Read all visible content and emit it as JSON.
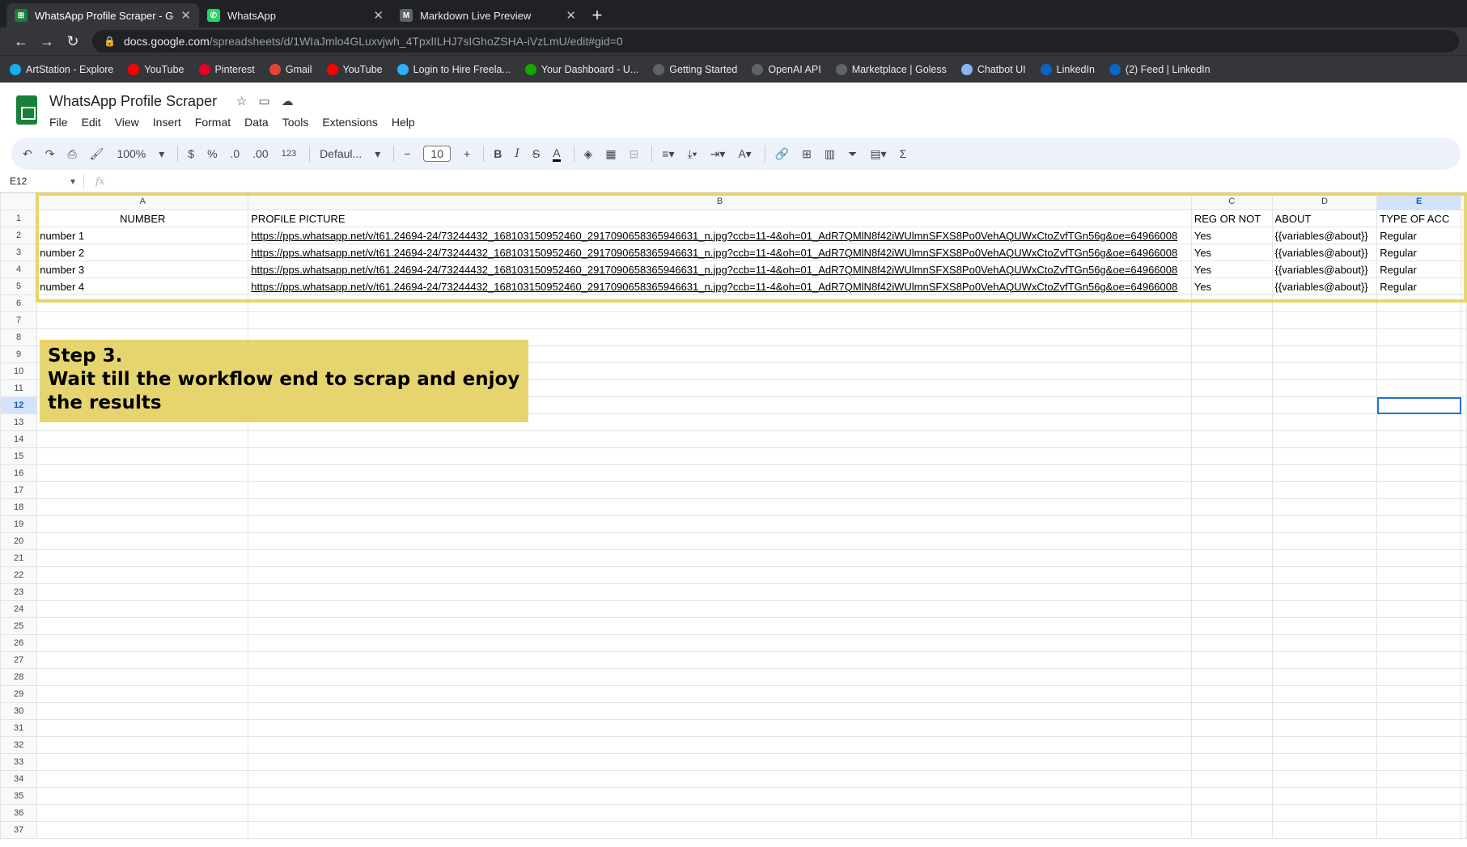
{
  "browser": {
    "tabs": [
      {
        "label": "WhatsApp Profile Scraper - Goog",
        "favicon_color": "#188038",
        "favicon_char": "⊞",
        "active": true
      },
      {
        "label": "WhatsApp",
        "favicon_color": "#25d366",
        "favicon_char": "✆",
        "active": false
      },
      {
        "label": "Markdown Live Preview",
        "favicon_color": "#5f6368",
        "favicon_char": "M",
        "active": false
      }
    ],
    "url_host": "docs.google.com",
    "url_path": "/spreadsheets/d/1WIaJmlo4GLuxvjwh_4TpxlILHJ7sIGhoZSHA-iVzLmU/edit#gid=0",
    "bookmarks": [
      {
        "label": "ArtStation - Explore",
        "color": "#13aff0"
      },
      {
        "label": "YouTube",
        "color": "#ff0000"
      },
      {
        "label": "Pinterest",
        "color": "#e60023"
      },
      {
        "label": "Gmail",
        "color": "#ea4335"
      },
      {
        "label": "YouTube",
        "color": "#ff0000"
      },
      {
        "label": "Login to Hire Freela...",
        "color": "#29b2fe"
      },
      {
        "label": "Your Dashboard - U...",
        "color": "#14a800"
      },
      {
        "label": "Getting Started",
        "color": "#5f6368"
      },
      {
        "label": "OpenAI API",
        "color": "#5f6368"
      },
      {
        "label": "Marketplace | Goless",
        "color": "#5f6368"
      },
      {
        "label": "Chatbot UI",
        "color": "#8ab4f8"
      },
      {
        "label": "LinkedIn",
        "color": "#0a66c2"
      },
      {
        "label": "(2) Feed | LinkedIn",
        "color": "#0a66c2"
      }
    ]
  },
  "doc": {
    "title": "WhatsApp Profile Scraper",
    "menu": [
      "File",
      "Edit",
      "View",
      "Insert",
      "Format",
      "Data",
      "Tools",
      "Extensions",
      "Help"
    ]
  },
  "format_bar": {
    "zoom": "100%",
    "currency": "$",
    "percent": "%",
    "dec_less": ".0",
    "dec_more": ".00",
    "num_format": "123",
    "font": "Defaul...",
    "font_size": "10"
  },
  "formula_bar": {
    "name_box": "E12",
    "fx": "fx"
  },
  "grid": {
    "columns": [
      "A",
      "B",
      "C",
      "D",
      "E"
    ],
    "header_row": [
      "NUMBER",
      "PROFILE PICTURE",
      "REG OR NOT",
      "ABOUT",
      "TYPE OF ACC"
    ],
    "rows": [
      [
        "number 1",
        "https://pps.whatsapp.net/v/t61.24694-24/73244432_168103150952460_2917090658365946631_n.jpg?ccb=11-4&oh=01_AdR7QMlN8f42iWUlmnSFXS8Po0VehAQUWxCtoZvfTGn56g&oe=64966008",
        "Yes",
        "{{variables@about}}",
        "Regular"
      ],
      [
        "number 2",
        "https://pps.whatsapp.net/v/t61.24694-24/73244432_168103150952460_2917090658365946631_n.jpg?ccb=11-4&oh=01_AdR7QMlN8f42iWUlmnSFXS8Po0VehAQUWxCtoZvfTGn56g&oe=64966008",
        "Yes",
        "{{variables@about}}",
        "Regular"
      ],
      [
        "number 3",
        "https://pps.whatsapp.net/v/t61.24694-24/73244432_168103150952460_2917090658365946631_n.jpg?ccb=11-4&oh=01_AdR7QMlN8f42iWUlmnSFXS8Po0VehAQUWxCtoZvfTGn56g&oe=64966008",
        "Yes",
        "{{variables@about}}",
        "Regular"
      ],
      [
        "number 4",
        "https://pps.whatsapp.net/v/t61.24694-24/73244432_168103150952460_2917090658365946631_n.jpg?ccb=11-4&oh=01_AdR7QMlN8f42iWUlmnSFXS8Po0VehAQUWxCtoZvfTGn56g&oe=64966008",
        "Yes",
        "{{variables@about}}",
        "Regular"
      ]
    ],
    "row_count": 37,
    "active_cell": "E12"
  },
  "callout": {
    "line1": "Step 3.",
    "line2": "Wait till the workflow end to scrap and enjoy the results"
  }
}
